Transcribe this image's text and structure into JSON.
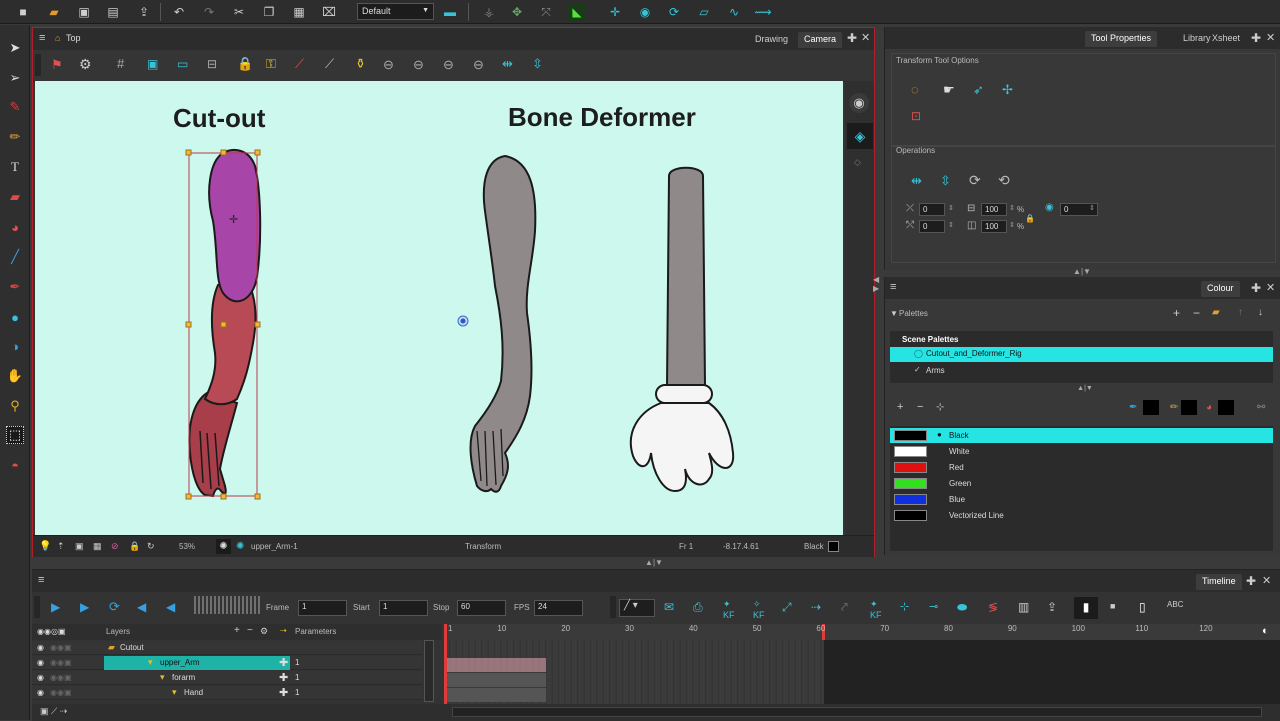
{
  "toolbar": {
    "workspace": "Default"
  },
  "camera_view": {
    "breadcrumb": "Top",
    "tabs": [
      "Drawing",
      "Camera"
    ],
    "canvas": {
      "title_left": "Cut-out",
      "title_right": "Bone Deformer",
      "bg_color": "#cdf8ee"
    },
    "status": {
      "zoom": "53%",
      "layer": "upper_Arm-1",
      "mode": "Transform",
      "frame": "Fr 1",
      "coords": "-8.17.4.61",
      "colour": "Black"
    }
  },
  "tool_properties": {
    "tabs": [
      "Tool Properties",
      "Library",
      "Xsheet"
    ],
    "section_title": "Transform Tool Options",
    "operations_title": "Operations",
    "fields": {
      "x": "0",
      "y": "0",
      "width": "100",
      "height": "100",
      "angle": "0",
      "pct": "%"
    }
  },
  "colour_panel": {
    "title": "Colour",
    "palettes_label": "Palettes",
    "scene_palettes": "Scene Palettes",
    "palettes": [
      {
        "name": "Cutout_and_Deformer_Rig",
        "selected": true
      },
      {
        "name": "Arms",
        "selected": false
      }
    ],
    "swatches": [
      {
        "name": "Black",
        "color": "#000000",
        "selected": true
      },
      {
        "name": "White",
        "color": "#ffffff",
        "selected": false
      },
      {
        "name": "Red",
        "color": "#e01010",
        "selected": false
      },
      {
        "name": "Green",
        "color": "#33e020",
        "selected": false
      },
      {
        "name": "Blue",
        "color": "#1030e0",
        "selected": false
      },
      {
        "name": "Vectorized Line",
        "color": "#000000",
        "selected": false
      }
    ]
  },
  "timeline": {
    "title": "Timeline",
    "frame_label": "Frame",
    "frame_value": "1",
    "start_label": "Start",
    "start_value": "1",
    "stop_label": "Stop",
    "stop_value": "60",
    "fps_label": "FPS",
    "fps_value": "24",
    "layers_header": "Layers",
    "parameters_header": "Parameters",
    "frame_numbers": [
      "1",
      "10",
      "20",
      "30",
      "40",
      "50",
      "60",
      "70",
      "80",
      "90",
      "100",
      "110",
      "120"
    ],
    "layers": [
      {
        "name": "Cutout",
        "value": "",
        "selected": false
      },
      {
        "name": "upper_Arm",
        "value": "1",
        "selected": true
      },
      {
        "name": "forarm",
        "value": "1",
        "selected": false
      },
      {
        "name": "Hand",
        "value": "1",
        "selected": false
      }
    ]
  }
}
